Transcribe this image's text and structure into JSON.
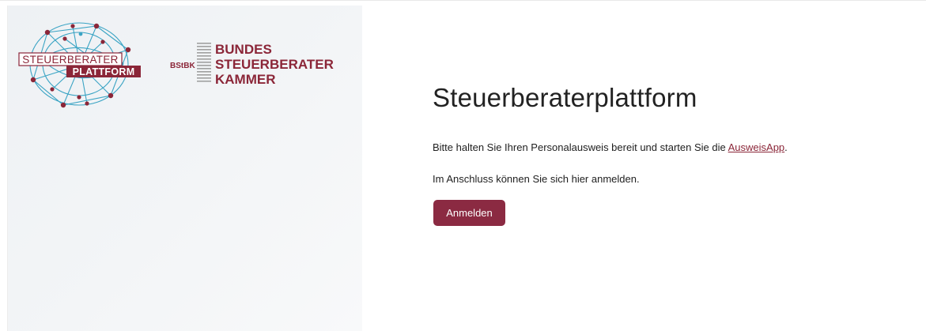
{
  "logos": {
    "platform_top": "STEUERBERATER",
    "platform_bottom": "PLATTFORM",
    "bstbk_abbr": "BStBK",
    "bstbk_line1": "BUNDES",
    "bstbk_line2": "STEUERBERATER",
    "bstbk_line3": "KAMMER",
    "brand_color": "#8b2638",
    "network_color": "#3ba4c4"
  },
  "main": {
    "title": "Steuerberaterplattform",
    "intro_before_link": "Bitte halten Sie Ihren Personalausweis bereit und starten Sie die ",
    "ausweisapp_link": "AusweisApp",
    "intro_after_link": ".",
    "followup": "Im Anschluss können Sie sich hier anmelden.",
    "login_label": "Anmelden",
    "button_color": "#8b2a42"
  }
}
